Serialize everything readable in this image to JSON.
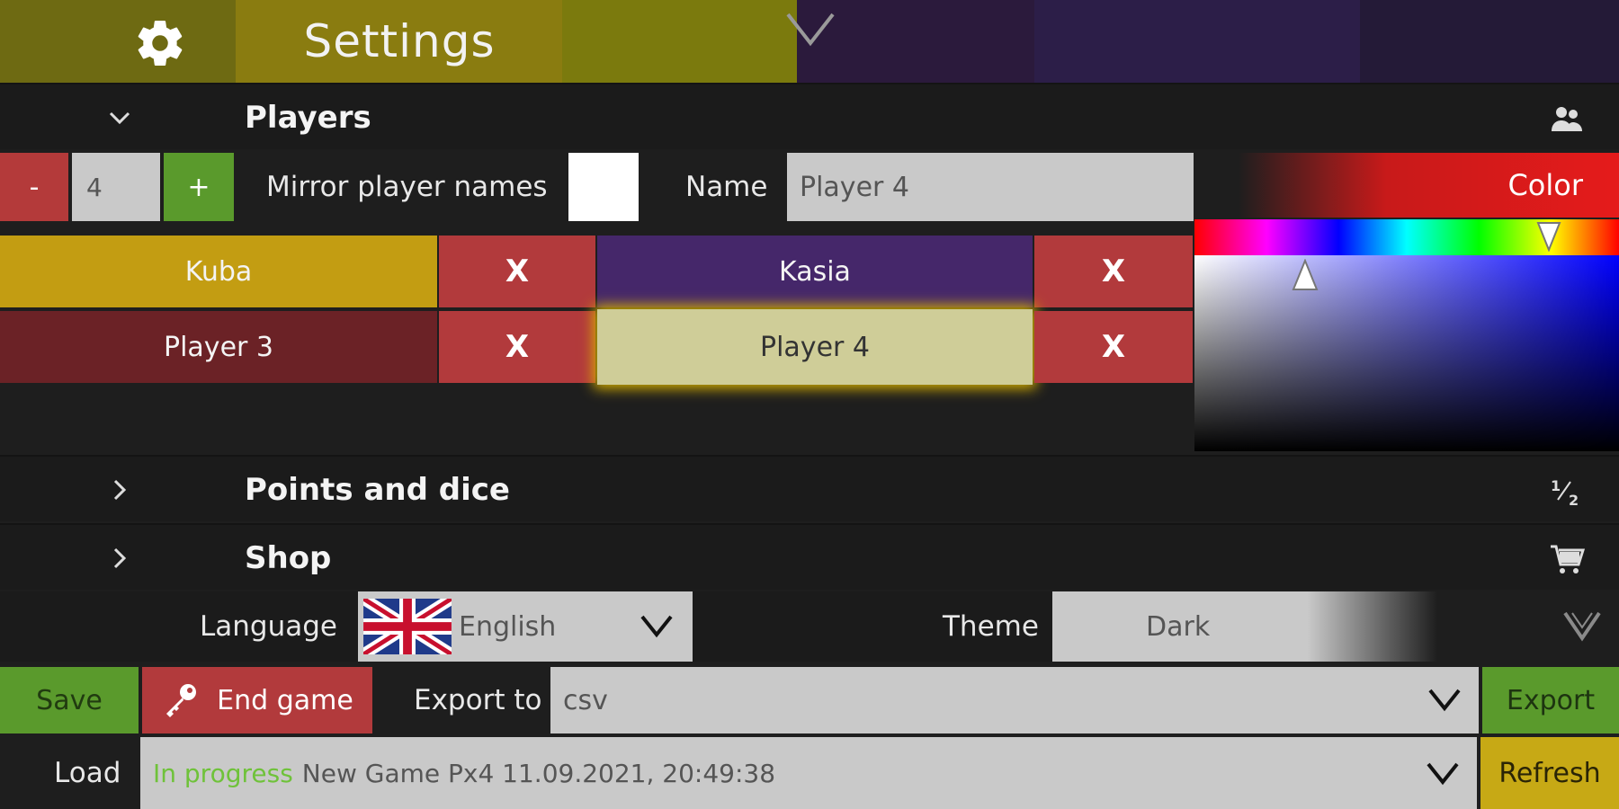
{
  "header": {
    "title": "Settings",
    "icon": "gear-icon"
  },
  "players_section": {
    "label": "Players",
    "icon": "players-icon",
    "count": "4",
    "minus_label": "-",
    "plus_label": "+",
    "mirror_label": "Mirror player names",
    "name_label": "Name",
    "name_value": "Player 4",
    "color_label": "Color",
    "selected_color": "#e51b1b",
    "players": [
      {
        "name": "Kuba",
        "color": "#c39d12"
      },
      {
        "name": "Kasia",
        "color": "#45276a"
      },
      {
        "name": "Player 3",
        "color": "#6b2226"
      },
      {
        "name": "Player 4",
        "color": "#cfcd98"
      }
    ],
    "remove_label": "X"
  },
  "points_section": {
    "label": "Points and dice",
    "icon": "points-icon"
  },
  "shop_section": {
    "label": "Shop",
    "icon": "cart-icon"
  },
  "language": {
    "label": "Language",
    "value": "English",
    "flag": "uk-flag-icon"
  },
  "theme": {
    "label": "Theme",
    "value": "Dark"
  },
  "actions": {
    "save_label": "Save",
    "end_game_label": "End game",
    "export_to_label": "Export to",
    "export_format": "csv",
    "export_label": "Export",
    "load_label": "Load",
    "load_status": "In progress",
    "load_value": "New Game Px4 11.09.2021, 20:49:38",
    "refresh_label": "Refresh"
  },
  "colors": {
    "accent_green": "#5a9a2c",
    "accent_red": "#b23a3c",
    "accent_yellow": "#c7a915"
  }
}
